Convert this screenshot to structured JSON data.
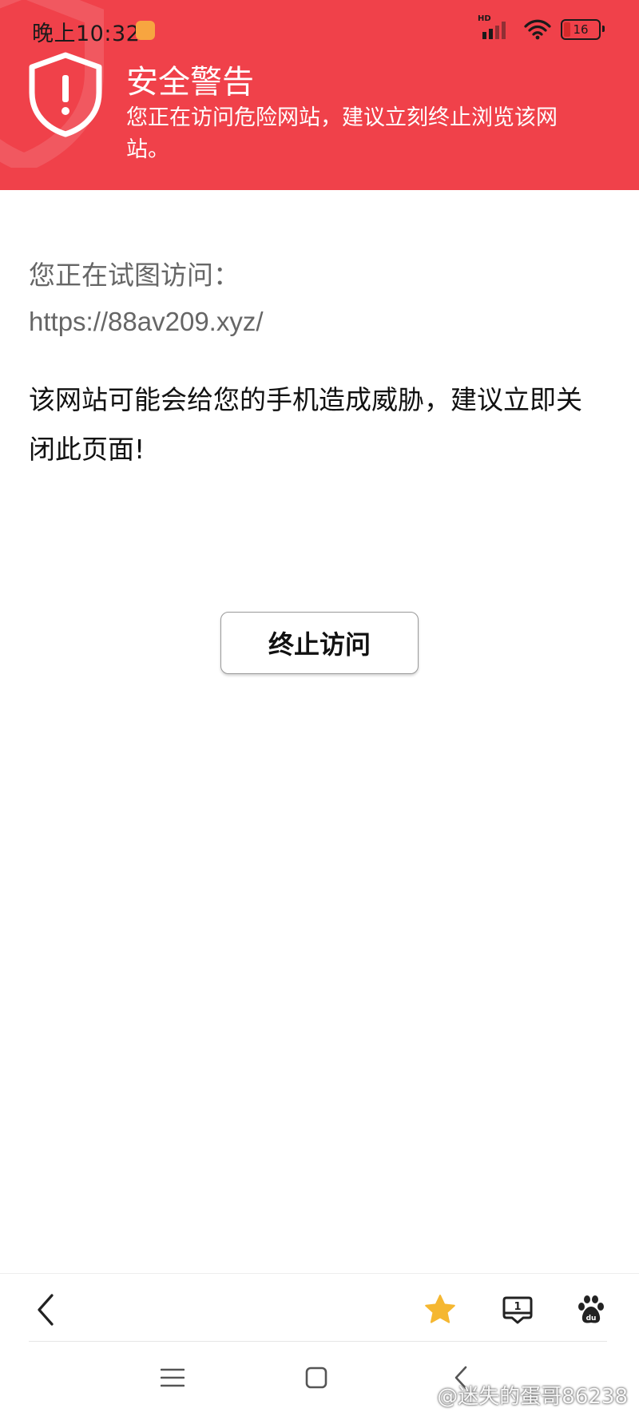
{
  "status_bar": {
    "time": "晚上10:32",
    "network_label": "HD",
    "battery": "16"
  },
  "warning": {
    "title": "安全警告",
    "subtitle": "您正在访问危险网站，建议立刻终止浏览该网站。"
  },
  "content": {
    "trying_label": "您正在试图访问：",
    "url": "https://88av209.xyz/",
    "threat_message": "该网站可能会给您的手机造成威胁，建议立即关闭此页面!",
    "stop_button": "终止访问"
  },
  "toolbar": {
    "tab_count": "1",
    "icons": [
      "back-icon",
      "star-icon",
      "tabs-icon",
      "baidu-paw-icon"
    ]
  },
  "system_nav": {
    "icons": [
      "menu-icon",
      "home-icon",
      "back-icon"
    ]
  },
  "watermark": "@迷失的蛋哥86238",
  "colors": {
    "header_bg": "#f0414a",
    "star": "#f5b731",
    "text_secondary": "#666666"
  }
}
